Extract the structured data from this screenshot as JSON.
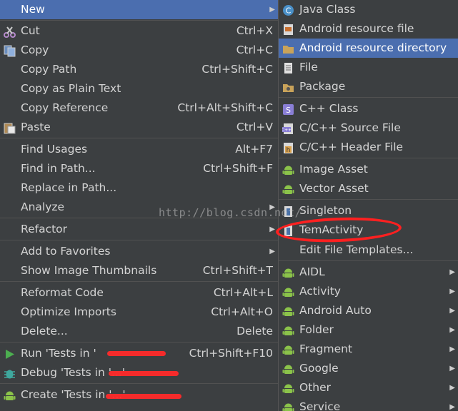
{
  "context_menu": {
    "items": [
      {
        "label": "New",
        "shortcut": "",
        "icon": "",
        "submenu": true,
        "selected": true
      },
      {
        "label": "Cut",
        "shortcut": "Ctrl+X",
        "icon": "scissors-icon"
      },
      {
        "label": "Copy",
        "shortcut": "Ctrl+C",
        "icon": "copy-icon"
      },
      {
        "label": "Copy Path",
        "shortcut": "Ctrl+Shift+C"
      },
      {
        "label": "Copy as Plain Text",
        "shortcut": ""
      },
      {
        "label": "Copy Reference",
        "shortcut": "Ctrl+Alt+Shift+C"
      },
      {
        "label": "Paste",
        "shortcut": "Ctrl+V",
        "icon": "paste-icon"
      },
      {
        "label": "Find Usages",
        "shortcut": "Alt+F7"
      },
      {
        "label": "Find in Path...",
        "shortcut": "Ctrl+Shift+F"
      },
      {
        "label": "Replace in Path...",
        "shortcut": ""
      },
      {
        "label": "Analyze",
        "shortcut": "",
        "submenu": true
      },
      {
        "label": "Refactor",
        "shortcut": "",
        "submenu": true
      },
      {
        "label": "Add to Favorites",
        "shortcut": "",
        "submenu": true
      },
      {
        "label": "Show Image Thumbnails",
        "shortcut": "Ctrl+Shift+T"
      },
      {
        "label": "Reformat Code",
        "shortcut": "Ctrl+Alt+L"
      },
      {
        "label": "Optimize Imports",
        "shortcut": "Ctrl+Alt+O"
      },
      {
        "label": "Delete...",
        "shortcut": "Delete"
      },
      {
        "label": "Run 'Tests in '",
        "shortcut": "Ctrl+Shift+F10",
        "icon": "run-icon"
      },
      {
        "label": "Debug 'Tests in '...'",
        "shortcut": "",
        "icon": "debug-icon"
      },
      {
        "label": "Create 'Tests in '...'",
        "shortcut": "",
        "icon": "android-icon"
      }
    ]
  },
  "new_submenu": {
    "items": [
      {
        "label": "Java Class",
        "icon": "java-class-icon"
      },
      {
        "label": "Android resource file",
        "icon": "resource-file-icon"
      },
      {
        "label": "Android resource directory",
        "icon": "folder-icon",
        "selected": true
      },
      {
        "label": "File",
        "icon": "file-icon"
      },
      {
        "label": "Package",
        "icon": "package-icon"
      },
      {
        "label": "C++ Class",
        "icon": "cpp-class-icon"
      },
      {
        "label": "C/C++ Source File",
        "icon": "cpp-source-icon"
      },
      {
        "label": "C/C++ Header File",
        "icon": "cpp-header-icon"
      },
      {
        "label": "Image Asset",
        "icon": "android-icon"
      },
      {
        "label": "Vector Asset",
        "icon": "android-icon"
      },
      {
        "label": "Singleton",
        "icon": "template-icon"
      },
      {
        "label": "TemActivity",
        "icon": "template-icon"
      },
      {
        "label": "Edit File Templates...",
        "icon": ""
      },
      {
        "label": "AIDL",
        "icon": "android-icon",
        "submenu": true
      },
      {
        "label": "Activity",
        "icon": "android-icon",
        "submenu": true
      },
      {
        "label": "Android Auto",
        "icon": "android-icon",
        "submenu": true
      },
      {
        "label": "Folder",
        "icon": "android-icon",
        "submenu": true
      },
      {
        "label": "Fragment",
        "icon": "android-icon",
        "submenu": true
      },
      {
        "label": "Google",
        "icon": "android-icon",
        "submenu": true
      },
      {
        "label": "Other",
        "icon": "android-icon",
        "submenu": true
      },
      {
        "label": "Service",
        "icon": "android-icon",
        "submenu": true
      }
    ]
  },
  "watermark": "http://blog.csdn.net/",
  "colors": {
    "menu_bg": "#3c3f41",
    "selection": "#4b6eaf",
    "text": "#d4d4d4",
    "annotation": "#ff2020"
  }
}
